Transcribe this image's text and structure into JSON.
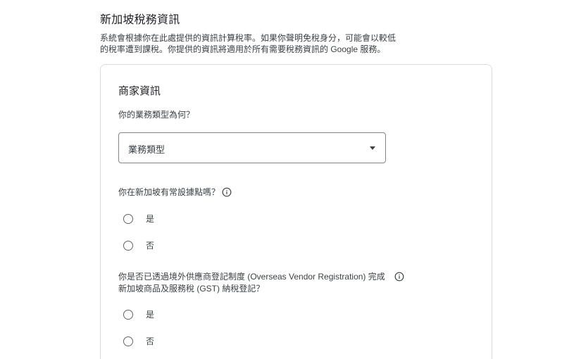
{
  "section": {
    "title": "新加坡稅務資訊",
    "description": "系統會根據你在此處提供的資訊計算稅率。如果你聲明免稅身分，可能會以較低的稅率遭到課稅。你提供的資訊將適用於所有需要稅務資訊的 Google 服務。"
  },
  "card": {
    "title": "商家資訊",
    "business_type": {
      "question": "你的業務類型為何？",
      "placeholder": "業務類型"
    },
    "residence": {
      "question": "你在新加坡有常設據點嗎？",
      "options": [
        "是",
        "否"
      ]
    },
    "ovr": {
      "question": "你是否已透過境外供應商登記制度 (Overseas Vendor Registration) 完成新加坡商品及服務稅 (GST) 納稅登記？",
      "options": [
        "是",
        "否"
      ]
    }
  },
  "icons": {
    "info": "info-icon",
    "dropdown": "arrow-drop-down-icon"
  },
  "colors": {
    "border": "#dadce0",
    "text": "#202124",
    "secondary_text": "#3c4043"
  }
}
